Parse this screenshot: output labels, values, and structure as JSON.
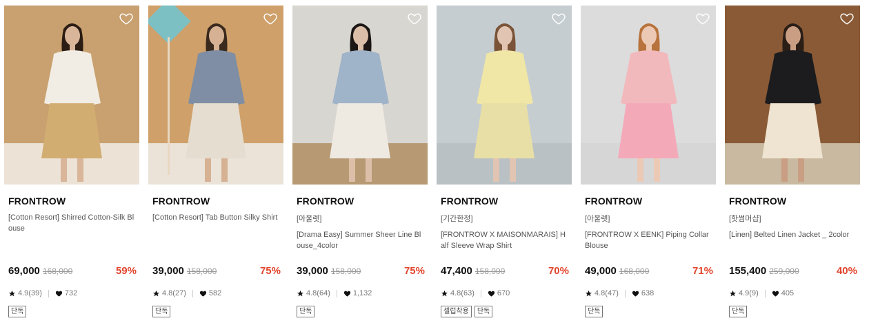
{
  "products": [
    {
      "brand": "FRONTROW",
      "category": "",
      "name": "[Cotton Resort] Shirred Cotton-Silk Blouse",
      "price": "69,000",
      "original_price": "168,000",
      "discount": "59%",
      "rating": "4.9(39)",
      "likes": "732",
      "tags": [
        "단독"
      ],
      "colors": {
        "bg": "#c9a06f",
        "floor": "#ece3d6",
        "shirt": "#f1ede4",
        "skirt": "#d2ad72",
        "hair": "#2b1d14",
        "skin": "#d9b59a"
      }
    },
    {
      "brand": "FRONTROW",
      "category": "",
      "name": "[Cotton Resort] Tab Button Silky Shirt",
      "price": "39,000",
      "original_price": "158,000",
      "discount": "75%",
      "rating": "4.8(27)",
      "likes": "582",
      "tags": [
        "단독"
      ],
      "colors": {
        "bg": "#cfa06a",
        "floor": "#ebe3d8",
        "shirt": "#7f8ea4",
        "skirt": "#e5ddcf",
        "hair": "#3a2a1e",
        "skin": "#d6b193",
        "accent": "#7cc0c4"
      }
    },
    {
      "brand": "FRONTROW",
      "category": "[아울렛]",
      "name": "[Drama Easy] Summer Sheer Line Blouse_4color",
      "price": "39,000",
      "original_price": "158,000",
      "discount": "75%",
      "rating": "4.8(64)",
      "likes": "1,132",
      "tags": [
        "단독"
      ],
      "colors": {
        "bg": "#d8d6d0",
        "floor": "#b79a73",
        "shirt": "#9fb3c9",
        "skirt": "#eeeae2",
        "hair": "#1c1715",
        "skin": "#dcbfa8"
      }
    },
    {
      "brand": "FRONTROW",
      "category": "[기간한정]",
      "name": "[FRONTROW X MAISONMARAIS] Half Sleeve Wrap Shirt",
      "price": "47,400",
      "original_price": "158,000",
      "discount": "70%",
      "rating": "4.8(63)",
      "likes": "670",
      "tags": [
        "셀럽착용",
        "단독"
      ],
      "colors": {
        "bg": "#c5cdd0",
        "floor": "#b9c1c4",
        "shirt": "#f0e6a6",
        "skirt": "#e8dfa6",
        "hair": "#7a5338",
        "skin": "#e2c4b2"
      }
    },
    {
      "brand": "FRONTROW",
      "category": "[아울렛]",
      "name": "[FRONTROW X EENK] Piping Collar Blouse",
      "price": "49,000",
      "original_price": "168,000",
      "discount": "71%",
      "rating": "4.8(47)",
      "likes": "638",
      "tags": [
        "단독"
      ],
      "colors": {
        "bg": "#dcdcdc",
        "floor": "#d6d6d6",
        "shirt": "#f2b9bd",
        "skirt": "#f4a9b9",
        "hair": "#b8733d",
        "skin": "#ecc9b5"
      }
    },
    {
      "brand": "FRONTROW",
      "category": "[핫썸머샵]",
      "name": "[Linen] Belted Linen Jacket _ 2color",
      "price": "155,400",
      "original_price": "259,000",
      "discount": "40%",
      "rating": "4.9(9)",
      "likes": "405",
      "tags": [
        "단독"
      ],
      "colors": {
        "bg": "#8a5a36",
        "floor": "#c8b9a0",
        "shirt": "#1c1c1e",
        "skirt": "#efe3d1",
        "hair": "#2a1e17",
        "skin": "#c99e83"
      }
    }
  ],
  "theme": {
    "discount_color": "#e2452d",
    "text": "#111111",
    "muted": "#777777"
  }
}
